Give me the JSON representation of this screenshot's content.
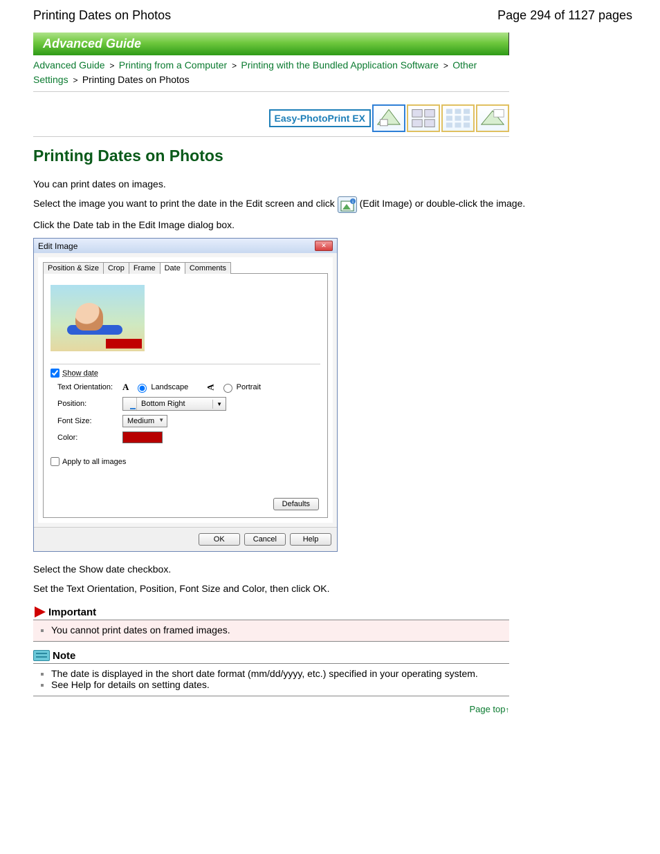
{
  "header": {
    "doc_title": "Printing Dates on Photos",
    "page_indicator": "Page 294 of 1127 pages"
  },
  "banner": {
    "text": "Advanced Guide"
  },
  "breadcrumb": {
    "items": [
      {
        "label": "Advanced Guide",
        "link": true
      },
      {
        "label": "Printing from a Computer",
        "link": true
      },
      {
        "label": "Printing with the Bundled Application Software",
        "link": true
      },
      {
        "label": "Other Settings",
        "link": true
      }
    ],
    "current": "Printing Dates on Photos"
  },
  "icon_strip": {
    "easy_label": "Easy-PhotoPrint EX"
  },
  "main": {
    "title": "Printing Dates on Photos",
    "intro": "You can print dates on images.",
    "select_line_a": "Select the image you want to print the date in the Edit screen and click",
    "select_line_b": "(Edit Image) or double-click the image.",
    "click_tab": "Click the Date tab in the Edit Image dialog box.",
    "after1": "Select the Show date checkbox.",
    "after2": "Set the Text Orientation, Position, Font Size and Color, then click OK."
  },
  "dialog": {
    "title": "Edit Image",
    "tabs": [
      "Position & Size",
      "Crop",
      "Frame",
      "Date",
      "Comments"
    ],
    "active_tab": "Date",
    "show_date_label": "Show date",
    "show_date_checked": true,
    "orientation_label": "Text Orientation:",
    "orientation_landscape": "Landscape",
    "orientation_portrait": "Portrait",
    "position_label": "Position:",
    "position_value": "Bottom Right",
    "font_size_label": "Font Size:",
    "font_size_value": "Medium",
    "color_label": "Color:",
    "apply_all_label": "Apply to all images",
    "defaults_btn": "Defaults",
    "ok_btn": "OK",
    "cancel_btn": "Cancel",
    "help_btn": "Help"
  },
  "important": {
    "heading": "Important",
    "items": [
      "You cannot print dates on framed images."
    ]
  },
  "note": {
    "heading": "Note",
    "items": [
      "The date is displayed in the short date format (mm/dd/yyyy, etc.) specified in your operating system.",
      "See Help for details on setting dates."
    ]
  },
  "page_top": {
    "label": "Page top"
  }
}
